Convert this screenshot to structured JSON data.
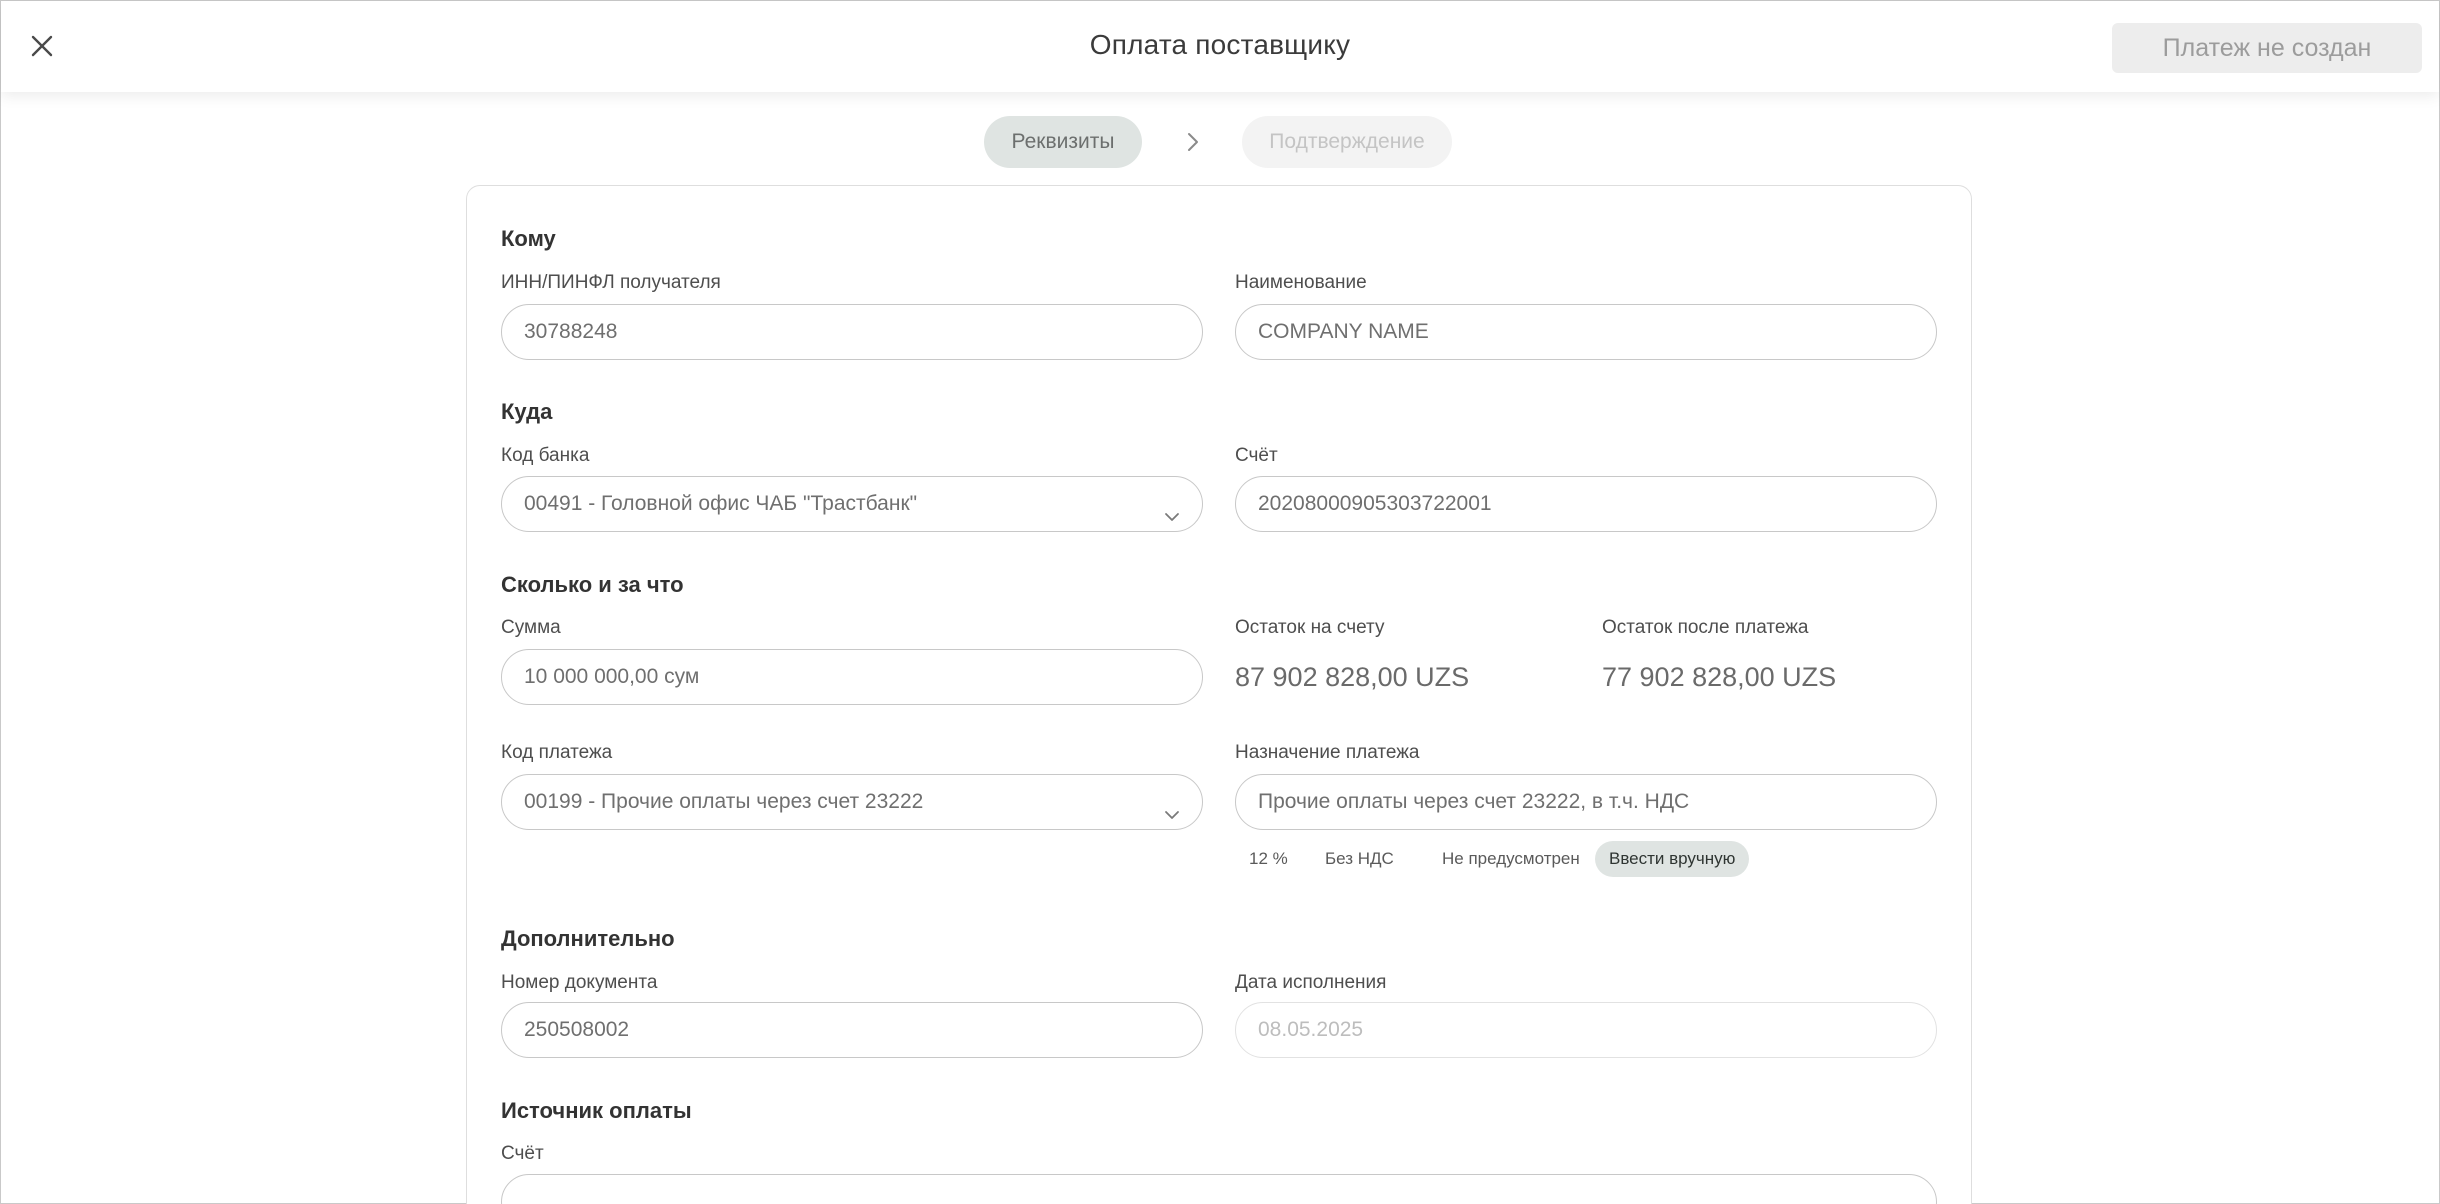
{
  "header": {
    "title": "Оплата поставщику",
    "status_button": "Платеж не создан",
    "close_icon": "close-icon"
  },
  "steps": [
    {
      "label": "Реквизиты",
      "state": "active"
    },
    {
      "label": "Подтверждение",
      "state": "disabled"
    }
  ],
  "to": {
    "section_title": "Кому",
    "inn_label": "ИНН/ПИНФЛ получателя",
    "inn_value": "30788248",
    "name_label": "Наименование",
    "name_value": "COMPANY NAME"
  },
  "where": {
    "section_title": "Куда",
    "bank_label": "Код банка",
    "bank_value": "00491 - Головной офис ЧАБ \"Трастбанк\"",
    "account_label": "Счёт",
    "account_value": "20208000905303722001"
  },
  "amount": {
    "section_title": "Сколько и за что",
    "sum_label": "Сумма",
    "sum_value": "10 000 000,00 сум",
    "balance_label": "Остаток на счету",
    "balance_value": "87 902 828,00 UZS",
    "after_label": "Остаток после платежа",
    "after_value": "77 902 828,00 UZS",
    "code_label": "Код платежа",
    "code_value": "00199 - Прочие оплаты через счет 23222",
    "purpose_label": "Назначение платежа",
    "purpose_value": "Прочие оплаты через счет 23222, в т.ч. НДС",
    "vat_options": [
      {
        "label": "12 %",
        "active": false
      },
      {
        "label": "Без НДС",
        "active": false
      },
      {
        "label": "Не предусмотрен",
        "active": false
      },
      {
        "label": "Ввести вручную",
        "active": true
      }
    ]
  },
  "extra": {
    "section_title": "Дополнительно",
    "docnum_label": "Номер документа",
    "docnum_value": "250508002",
    "date_label": "Дата исполнения",
    "date_value": "08.05.2025"
  },
  "source": {
    "section_title": "Источник оплаты",
    "account_label": "Счёт"
  },
  "colors": {
    "accent_chip": "#dfe4e2",
    "border": "#c8c8c8"
  }
}
